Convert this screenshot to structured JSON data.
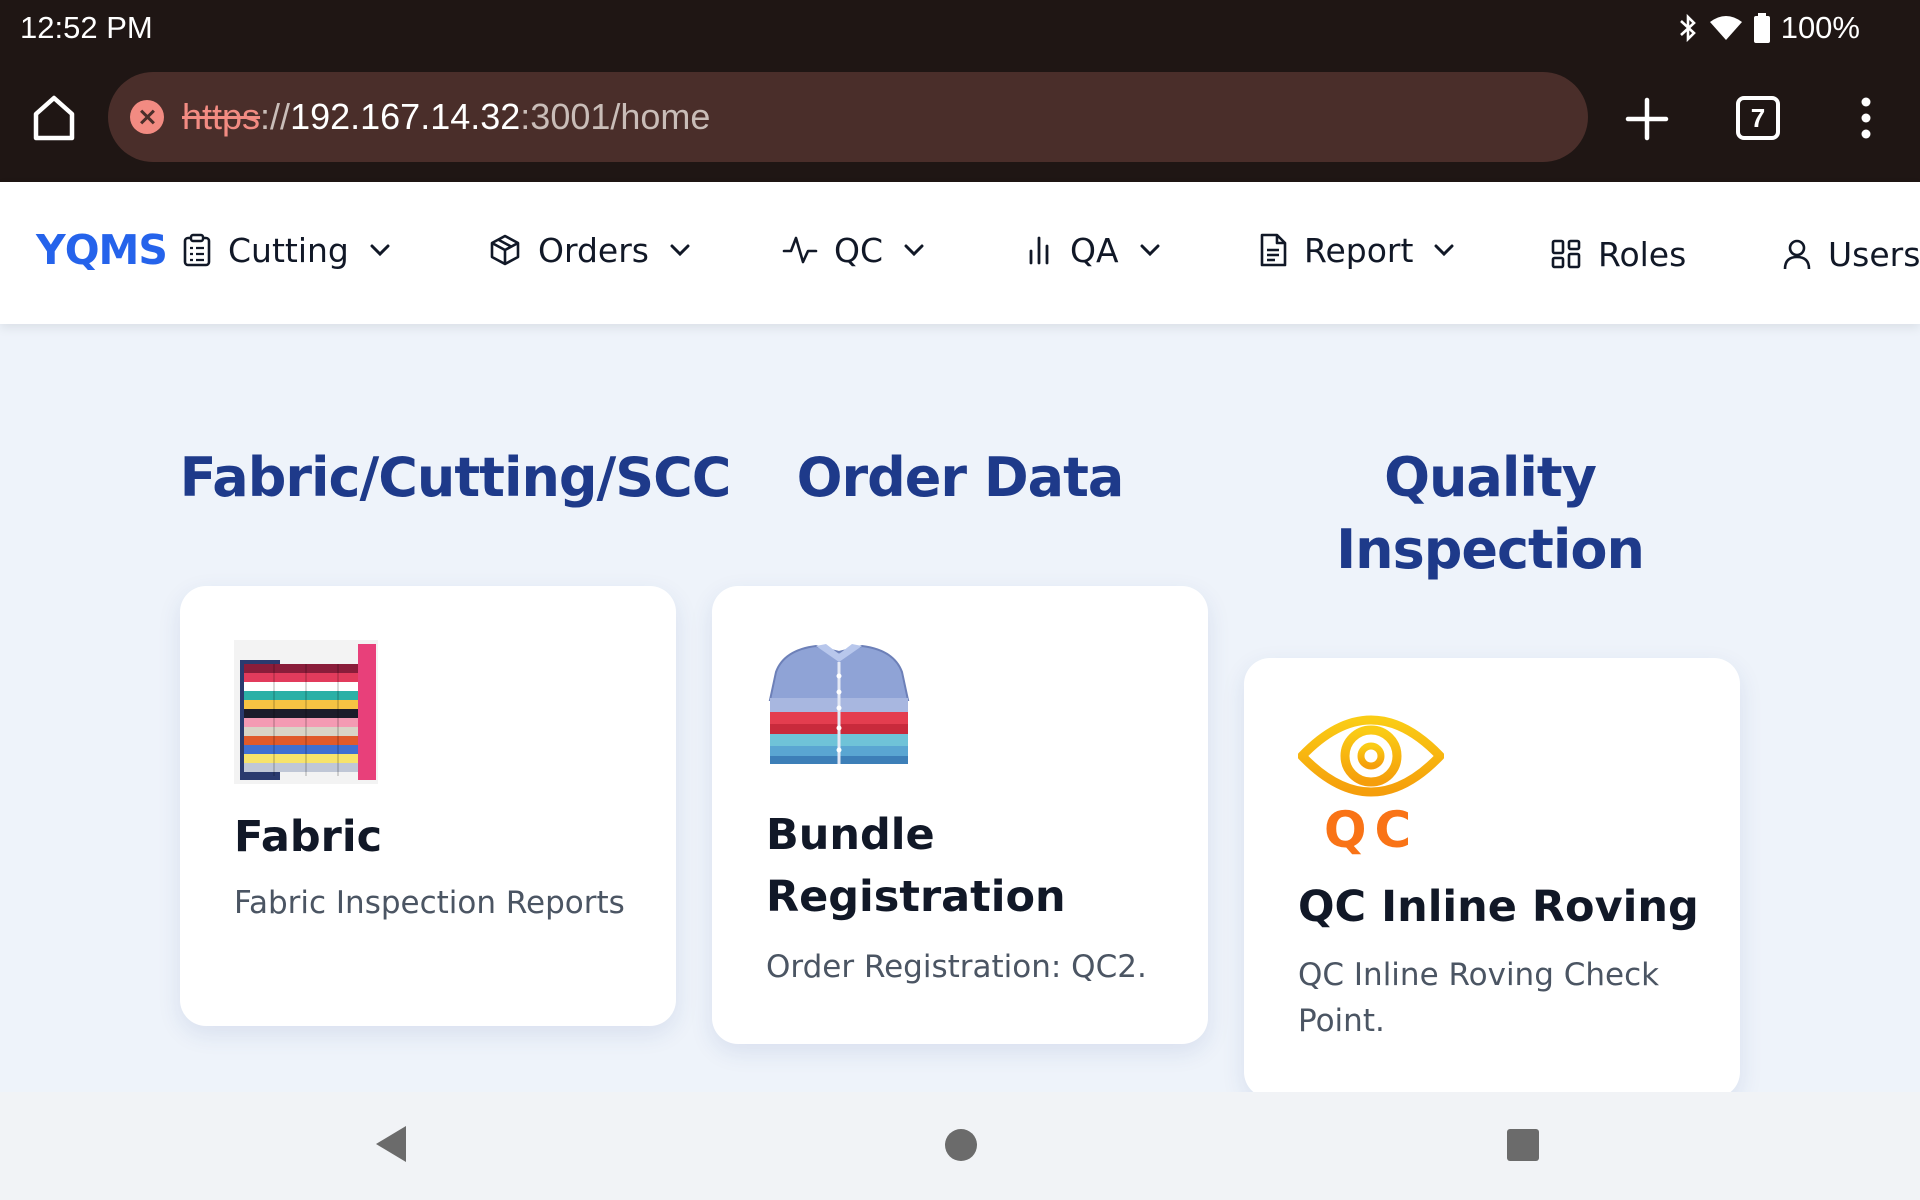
{
  "status_bar": {
    "time": "12:52 PM",
    "battery": "100%"
  },
  "browser": {
    "url_scheme": "https",
    "url_sep": "://",
    "url_host": "192.167.14.32",
    "url_path": ":3001/home",
    "tab_count": "7"
  },
  "app": {
    "brand": "YQMS",
    "nav": [
      {
        "label": "Cutting",
        "icon": "clipboard-icon"
      },
      {
        "label": "Orders",
        "icon": "package-icon"
      },
      {
        "label": "QC",
        "icon": "activity-icon"
      },
      {
        "label": "QA",
        "icon": "bar-chart-icon"
      },
      {
        "label": "Report",
        "icon": "file-text-icon"
      },
      {
        "label": "Roles",
        "icon": "grid-icon"
      },
      {
        "label": "Users",
        "icon": "user-icon"
      }
    ]
  },
  "sections": [
    {
      "title": "Fabric/Cutting/SCC",
      "card": {
        "title": "Fabric",
        "description": "Fabric Inspection Reports",
        "image": "folded-fabric-stack"
      }
    },
    {
      "title": "Order Data",
      "card": {
        "title": "Bundle Registration",
        "description": "Order Registration: QC2.",
        "image": "folded-shirt-stack"
      }
    },
    {
      "title": "Quality Inspection",
      "card": {
        "title": "QC Inline Roving",
        "description": "QC Inline Roving Check Point.",
        "image": "qc-eye-logo",
        "logo_text": "QC"
      }
    }
  ],
  "colors": {
    "brand": "#2563eb",
    "section_title": "#1e3a8a",
    "qc_orange": "#f97316",
    "qc_yellow": "#facc15"
  }
}
